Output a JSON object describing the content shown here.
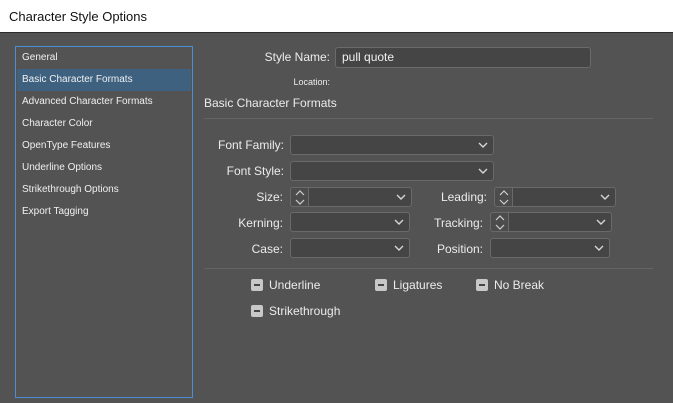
{
  "window": {
    "title": "Character Style Options"
  },
  "sidebar": {
    "items": [
      {
        "label": "General"
      },
      {
        "label": "Basic Character Formats"
      },
      {
        "label": "Advanced Character Formats"
      },
      {
        "label": "Character Color"
      },
      {
        "label": "OpenType Features"
      },
      {
        "label": "Underline Options"
      },
      {
        "label": "Strikethrough Options"
      },
      {
        "label": "Export Tagging"
      }
    ],
    "selected_index": 1,
    "selected_color": "#3e6180"
  },
  "style_name": {
    "label": "Style Name:",
    "value": "pull quote"
  },
  "location": {
    "label": "Location:"
  },
  "section_heading": "Basic Character Formats",
  "fields": {
    "font_family": {
      "label": "Font Family:",
      "value": ""
    },
    "font_style": {
      "label": "Font Style:",
      "value": ""
    },
    "size": {
      "label": "Size:",
      "value": ""
    },
    "leading": {
      "label": "Leading:",
      "value": ""
    },
    "kerning": {
      "label": "Kerning:",
      "value": ""
    },
    "tracking": {
      "label": "Tracking:",
      "value": ""
    },
    "case": {
      "label": "Case:",
      "value": ""
    },
    "position": {
      "label": "Position:",
      "value": ""
    }
  },
  "checkboxes": {
    "underline": {
      "label": "Underline",
      "state": "indeterminate"
    },
    "ligatures": {
      "label": "Ligatures",
      "state": "indeterminate"
    },
    "no_break": {
      "label": "No Break",
      "state": "indeterminate"
    },
    "strikethrough": {
      "label": "Strikethrough",
      "state": "indeterminate"
    }
  },
  "icons": {
    "dropdown": "chevron-down-icon",
    "stepper": "stepper-arrows-icon",
    "checkbox": "indeterminate-checkbox-icon"
  },
  "colors": {
    "panel_bg": "#535353",
    "accent_border": "#4d8fd4",
    "field_bg": "#454545"
  }
}
